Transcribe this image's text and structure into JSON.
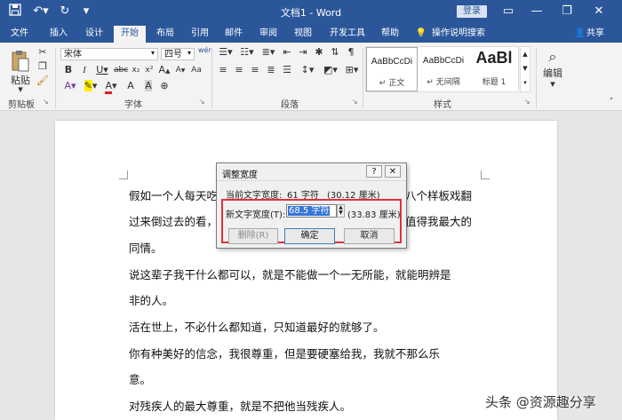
{
  "titlebar": {
    "doc_title": "文档1 - Word",
    "login": "登录",
    "minimize": "—",
    "restore": "❐",
    "close": "✕"
  },
  "tabs": [
    "文件",
    "插入",
    "设计",
    "开始",
    "布局",
    "引用",
    "邮件",
    "审阅",
    "视图",
    "开发工具",
    "帮助"
  ],
  "active_tab": "开始",
  "tellme": "操作说明搜索",
  "share": "共享",
  "ribbon": {
    "paste_label": "粘贴",
    "clipboard_label": "剪贴板",
    "font_name": "宋体",
    "font_size": "四号",
    "font_group": "字体",
    "para_group": "段落",
    "styles_group": "样式",
    "edit_label": "编辑",
    "styles": [
      {
        "preview": "AaBbCcDi",
        "name": "↵ 正文"
      },
      {
        "preview": "AaBbCcDi",
        "name": "↵ 无间隔"
      },
      {
        "preview": "AaBl",
        "name": "标题 1"
      }
    ]
  },
  "document": {
    "paragraphs": [
      "假如一个人每天吃",
      "过来倒过去的看，",
      "同情。",
      "说这辈子我干什么都可以，就是不能做一个一无所能，就能明辨是",
      "非的人。",
      "活在世上，不必什么都知道，只知道最好的就够了。",
      "你有种美好的信念，我很尊重，但是要硬塞给我，我就不那么乐",
      "意。",
      "对残疾人的最大尊重，就是不把他当残疾人。"
    ],
    "right_fragments": [
      "八个样板戏翻",
      "值得我最大的"
    ]
  },
  "dialog": {
    "title": "调整宽度",
    "help": "?",
    "close": "✕",
    "current_label": "当前文字宽度:",
    "current_chars": "61 字符",
    "current_cm": "(30.12 厘米)",
    "new_label": "新文字宽度(T):",
    "new_value": "68.5 字符",
    "new_cm": "(33.83 厘米)",
    "delete_btn": "删除(R)",
    "ok_btn": "确定",
    "cancel_btn": "取消"
  },
  "watermark": "头条 @资源趣分享"
}
